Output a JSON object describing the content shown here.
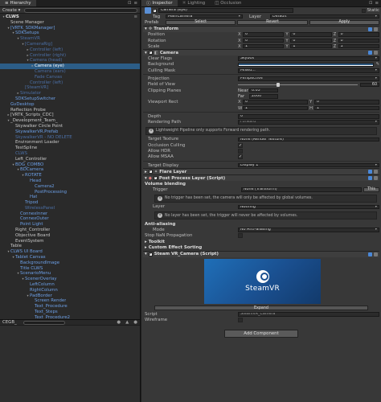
{
  "hierarchy": {
    "tab_label": "Hierarchy",
    "create_label": "Create ▾",
    "search_placeholder": "",
    "nodes": [
      {
        "indent": 0,
        "arrow": "▾",
        "label": "CLWS",
        "kind": "scene"
      },
      {
        "indent": 1,
        "arrow": "",
        "label": "Scene Manager",
        "kind": "normal"
      },
      {
        "indent": 1,
        "arrow": "▾",
        "label": "[VRTK_SDKManager]",
        "kind": "prefab"
      },
      {
        "indent": 2,
        "arrow": "▾",
        "label": "SDKSetups",
        "kind": "prefab"
      },
      {
        "indent": 3,
        "arrow": "▾",
        "label": "SteamVR",
        "kind": "dim"
      },
      {
        "indent": 4,
        "arrow": "▾",
        "label": "[CameraRig]",
        "kind": "dim"
      },
      {
        "indent": 5,
        "arrow": "▸",
        "label": "Controller (left)",
        "kind": "dim"
      },
      {
        "indent": 5,
        "arrow": "▸",
        "label": "Controller (right)",
        "kind": "dim"
      },
      {
        "indent": 5,
        "arrow": "▾",
        "label": "Camera (head)",
        "kind": "dim"
      },
      {
        "indent": 6,
        "arrow": "▸",
        "label": "Camera (eye)",
        "kind": "selected"
      },
      {
        "indent": 6,
        "arrow": "",
        "label": "Camera (ears)",
        "kind": "dim"
      },
      {
        "indent": 6,
        "arrow": "",
        "label": "Fade Canvas",
        "kind": "dim"
      },
      {
        "indent": 5,
        "arrow": "",
        "label": "Controller (left)",
        "kind": "dim"
      },
      {
        "indent": 4,
        "arrow": "",
        "label": "[SteamVR]",
        "kind": "dim"
      },
      {
        "indent": 3,
        "arrow": "▸",
        "label": "Simulator",
        "kind": "dim"
      },
      {
        "indent": 2,
        "arrow": "",
        "label": "SDKSetupSwitcher",
        "kind": "prefab"
      },
      {
        "indent": 1,
        "arrow": "",
        "label": "GvDesktop",
        "kind": "prefab"
      },
      {
        "indent": 1,
        "arrow": "",
        "label": "Reflection Probe",
        "kind": "normal"
      },
      {
        "indent": 1,
        "arrow": "▸",
        "label": "[VRTK_Scripts_CDC]",
        "kind": "normal"
      },
      {
        "indent": 1,
        "arrow": "▾",
        "label": "_Development_Team_",
        "kind": "normal"
      },
      {
        "indent": 2,
        "arrow": "",
        "label": "Skywalker Circle Point",
        "kind": "normal"
      },
      {
        "indent": 2,
        "arrow": "",
        "label": "SkywalkerVR.Prefab",
        "kind": "prefab"
      },
      {
        "indent": 2,
        "arrow": "",
        "label": "SkywalkerVR - NO DELETE",
        "kind": "dim"
      },
      {
        "indent": 2,
        "arrow": "",
        "label": "Environment Loader",
        "kind": "normal"
      },
      {
        "indent": 2,
        "arrow": "",
        "label": "TestSpline",
        "kind": "normal"
      },
      {
        "indent": 2,
        "arrow": "",
        "label": "CLWS",
        "kind": "dim"
      },
      {
        "indent": 2,
        "arrow": "",
        "label": "Left_Controller",
        "kind": "normal"
      },
      {
        "indent": 2,
        "arrow": "▾",
        "label": "BDG_COMBO",
        "kind": "prefab"
      },
      {
        "indent": 3,
        "arrow": "▾",
        "label": "BDCamera",
        "kind": "prefab"
      },
      {
        "indent": 4,
        "arrow": "▾",
        "label": "ROTATE",
        "kind": "prefab"
      },
      {
        "indent": 5,
        "arrow": "",
        "label": "Head",
        "kind": "prefab"
      },
      {
        "indent": 6,
        "arrow": "",
        "label": "Camera2",
        "kind": "prefab"
      },
      {
        "indent": 6,
        "arrow": "",
        "label": "PostProcessing",
        "kind": "prefab"
      },
      {
        "indent": 5,
        "arrow": "",
        "label": "Hat",
        "kind": "prefab"
      },
      {
        "indent": 4,
        "arrow": "",
        "label": "Tripod",
        "kind": "prefab"
      },
      {
        "indent": 4,
        "arrow": "",
        "label": "WirelessPanel",
        "kind": "dim"
      },
      {
        "indent": 3,
        "arrow": "",
        "label": "ConnexInner",
        "kind": "prefab"
      },
      {
        "indent": 3,
        "arrow": "",
        "label": "ConnexOuter",
        "kind": "prefab"
      },
      {
        "indent": 3,
        "arrow": "",
        "label": "Point Light",
        "kind": "prefab"
      },
      {
        "indent": 2,
        "arrow": "",
        "label": "Right_Controller",
        "kind": "normal"
      },
      {
        "indent": 2,
        "arrow": "",
        "label": "Objective Board",
        "kind": "normal"
      },
      {
        "indent": 2,
        "arrow": "",
        "label": "EventSystem",
        "kind": "normal"
      },
      {
        "indent": 1,
        "arrow": "",
        "label": "Table",
        "kind": "normal"
      },
      {
        "indent": 1,
        "arrow": "▾",
        "label": "CLWS UI Board",
        "kind": "prefab"
      },
      {
        "indent": 2,
        "arrow": "▾",
        "label": "Tablet Canvas",
        "kind": "prefab"
      },
      {
        "indent": 3,
        "arrow": "",
        "label": "BackgroundImage",
        "kind": "prefab"
      },
      {
        "indent": 3,
        "arrow": "",
        "label": "Title CLWS",
        "kind": "prefab"
      },
      {
        "indent": 3,
        "arrow": "▾",
        "label": "ScenarioMenu",
        "kind": "prefab"
      },
      {
        "indent": 4,
        "arrow": "▾",
        "label": "ScenerOverlay",
        "kind": "prefab"
      },
      {
        "indent": 5,
        "arrow": "",
        "label": "LeftColumn",
        "kind": "prefab"
      },
      {
        "indent": 5,
        "arrow": "",
        "label": "RightColumn",
        "kind": "prefab"
      },
      {
        "indent": 5,
        "arrow": "▾",
        "label": "PadBorder",
        "kind": "prefab"
      },
      {
        "indent": 6,
        "arrow": "",
        "label": "Screen Render",
        "kind": "prefab"
      },
      {
        "indent": 6,
        "arrow": "",
        "label": "Text_Procedure",
        "kind": "prefab"
      },
      {
        "indent": 6,
        "arrow": "",
        "label": "Text_Steps",
        "kind": "prefab"
      },
      {
        "indent": 6,
        "arrow": "",
        "label": "Text_Procedure2",
        "kind": "prefab"
      },
      {
        "indent": 6,
        "arrow": "",
        "label": "Text_Steps",
        "kind": "prefab"
      }
    ]
  },
  "console": {
    "search_label": "CEGB_"
  },
  "tabs": {
    "inspector": "Inspector",
    "lighting": "Lighting",
    "occlusion": "Occlusion"
  },
  "object": {
    "name": "Camera (eye)",
    "static_label": "Static",
    "tag_label": "Tag",
    "tag_value": "MainCamera",
    "layer_label": "Layer",
    "layer_value": "Default",
    "prefab_label": "Prefab",
    "prefab_select": "Select",
    "prefab_revert": "Revert",
    "prefab_apply": "Apply"
  },
  "transform": {
    "title": "Transform",
    "position_label": "Position",
    "rotation_label": "Rotation",
    "scale_label": "Scale",
    "position": [
      "0",
      "0",
      "0"
    ],
    "rotation": [
      "0",
      "0",
      "0"
    ],
    "scale": [
      "1",
      "1",
      "1"
    ],
    "x": "X",
    "y": "Y",
    "z": "Z"
  },
  "camera": {
    "title": "Camera",
    "clear_flags_label": "Clear Flags",
    "clear_flags_value": "Skybox",
    "background_label": "Background",
    "culling_mask_label": "Culling Mask",
    "culling_mask_value": "Mixed...",
    "projection_label": "Projection",
    "projection_value": "Perspective",
    "fov_label": "Field of View",
    "fov_value": 60,
    "fov_max": 179,
    "clipping_label": "Clipping Planes",
    "near_label": "Near",
    "near_value": "0.05",
    "far_label": "Far",
    "far_value": "2000",
    "viewport_label": "Viewport Rect",
    "vp_x": "0",
    "vp_y": "0",
    "vp_w": "1",
    "vp_h": "1",
    "x": "X",
    "y": "Y",
    "w": "W",
    "h": "H",
    "depth_label": "Depth",
    "depth_value": "0",
    "rendering_path_label": "Rendering Path",
    "rendering_path_value": "Forward",
    "info_text": "Lightweight Pipeline only supports Forward rendering path.",
    "target_texture_label": "Target Texture",
    "target_texture_value": "None (Render Texture)",
    "occlusion_label": "Occlusion Culling",
    "hdr_label": "Allow HDR",
    "msaa_label": "Allow MSAA",
    "target_display_label": "Target Display",
    "target_display_value": "Display 1",
    "occlusion_checked": true,
    "hdr_checked": false,
    "msaa_checked": true
  },
  "flare": {
    "title": "Flare Layer"
  },
  "ppl": {
    "title": "Post Process Layer (Script)",
    "volume_blending_label": "Volume blending",
    "trigger_label": "Trigger",
    "trigger_value": "None (Transform)",
    "this_label": "This",
    "info1": "No trigger has been set, the camera will only be affected by global volumes.",
    "layer_label": "Layer",
    "layer_value": "Nothing",
    "info2": "No layer has been set, the trigger will never be affected by volumes.",
    "aa_label": "Anti-aliasing",
    "mode_label": "Mode",
    "mode_value": "No Anti-aliasing",
    "stopnan_label": "Stop NaN Propagation",
    "toolkit_label": "Toolkit",
    "custom_label": "Custom Effect Sorting"
  },
  "steam": {
    "title": "Steam VR_Camera (Script)",
    "logo_text": "SteamVR",
    "expand_label": "Expand",
    "script_label": "Script",
    "script_value": "SteamVR_Camera",
    "wireframe_label": "Wireframe"
  },
  "add_component_label": "Add Component",
  "colors": {
    "accent": "#2c5d87",
    "prefab_text": "#6c9fe6",
    "panel_bg": "#383838"
  }
}
